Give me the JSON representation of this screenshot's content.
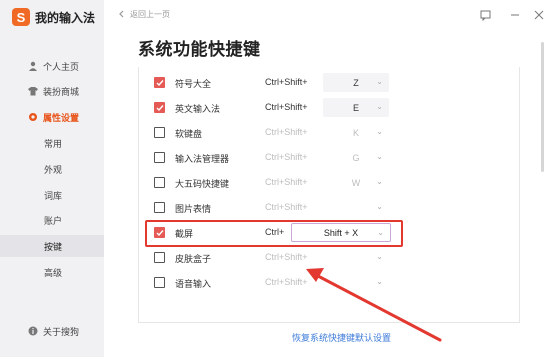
{
  "app": {
    "name": "我的输入法",
    "logo_letter": "S",
    "accent": "#f06a25"
  },
  "sidebar": {
    "items": [
      {
        "label": "个人主页",
        "icon": "user-icon"
      },
      {
        "label": "装扮商城",
        "icon": "shirt-icon"
      },
      {
        "label": "属性设置",
        "icon": "gear-icon",
        "active": true
      },
      {
        "label": "常用"
      },
      {
        "label": "外观"
      },
      {
        "label": "词库"
      },
      {
        "label": "账户"
      },
      {
        "label": "按键",
        "selected": true
      },
      {
        "label": "高级"
      }
    ],
    "about": "关于搜狗"
  },
  "header": {
    "back_label": "返回上一页",
    "title": "系统功能快捷键"
  },
  "shortcuts": [
    {
      "label": "符号大全",
      "checked": true,
      "modifier": "Ctrl+Shift+",
      "key": "Z",
      "enabled": true
    },
    {
      "label": "英文输入法",
      "checked": true,
      "modifier": "Ctrl+Shift+",
      "key": "E",
      "enabled": true
    },
    {
      "label": "软键盘",
      "checked": false,
      "modifier": "Ctrl+Shift+",
      "key": "K",
      "enabled": false
    },
    {
      "label": "输入法管理器",
      "checked": false,
      "modifier": "Ctrl+Shift+",
      "key": "G",
      "enabled": false
    },
    {
      "label": "大五码快捷键",
      "checked": false,
      "modifier": "Ctrl+Shift+",
      "key": "W",
      "enabled": false
    },
    {
      "label": "图片表情",
      "checked": false,
      "modifier": "Ctrl+Shift+",
      "key": "",
      "enabled": false
    },
    {
      "label": "截屏",
      "checked": true,
      "modifier": "Ctrl+",
      "key": "Shift + X",
      "enabled": true
    },
    {
      "label": "皮肤盒子",
      "checked": false,
      "modifier": "Ctrl+Shift+",
      "key": "",
      "enabled": false
    },
    {
      "label": "语音输入",
      "checked": false,
      "modifier": "Ctrl+Shift+",
      "key": "",
      "enabled": false
    }
  ],
  "footer": {
    "reset_label": "恢复系统快捷键默认设置"
  },
  "colors": {
    "checkbox_on": "#e55a55",
    "highlight": "#e3382f",
    "link": "#3d7bd8"
  }
}
